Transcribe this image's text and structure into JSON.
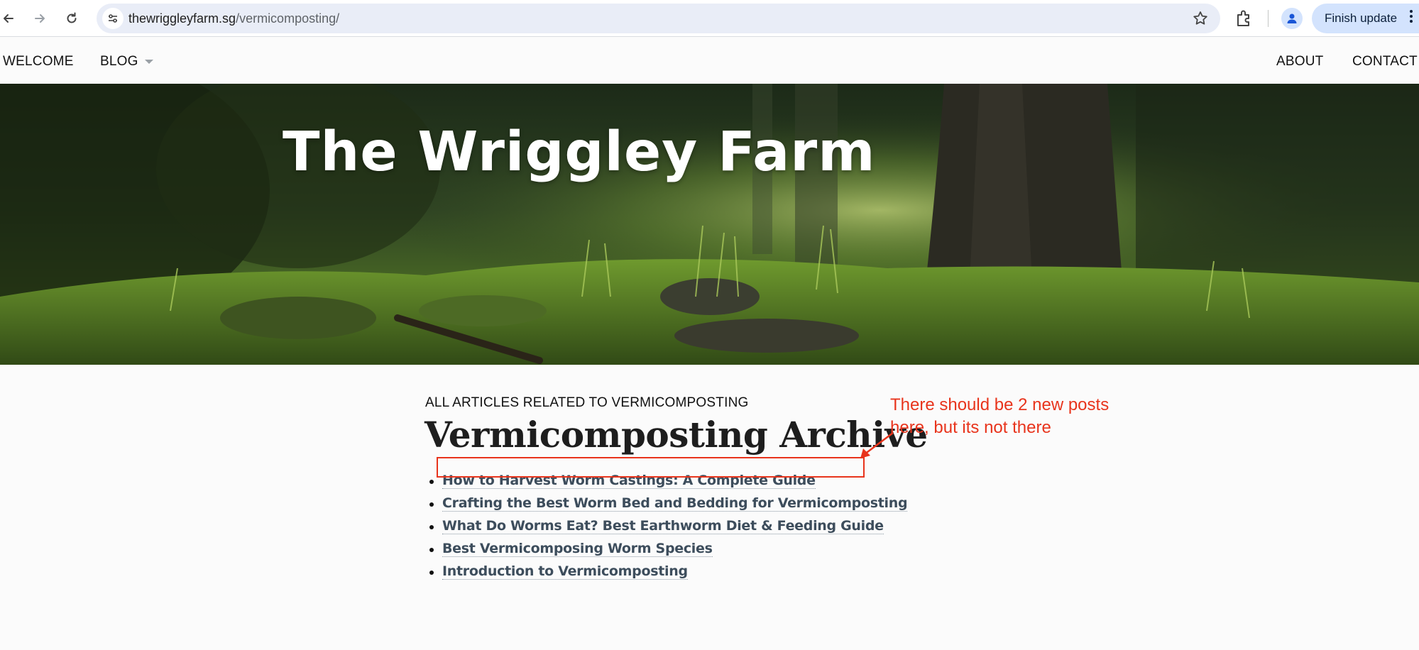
{
  "browser": {
    "url_domain": "thewriggleyfarm.sg",
    "url_path": "/vermicomposting/",
    "finish_update_label": "Finish update"
  },
  "nav": {
    "welcome": "WELCOME",
    "blog": "BLOG",
    "about": "ABOUT",
    "contact": "CONTACT"
  },
  "hero": {
    "title": "The Wriggley Farm"
  },
  "page": {
    "kicker": "ALL ARTICLES RELATED TO VERMICOMPOSTING",
    "title": "Vermicomposting Archive",
    "posts": [
      "How to Harvest Worm Castings: A Complete Guide",
      "Crafting the Best Worm Bed and Bedding for Vermicomposting",
      "What Do Worms Eat? Best Earthworm Diet & Feeding Guide",
      "Best Vermicomposing Worm Species",
      "Introduction to Vermicomposting"
    ]
  },
  "annotation": {
    "line1": "There should be 2 new posts",
    "line2": "here, but its not there",
    "color": "#e8341c"
  }
}
